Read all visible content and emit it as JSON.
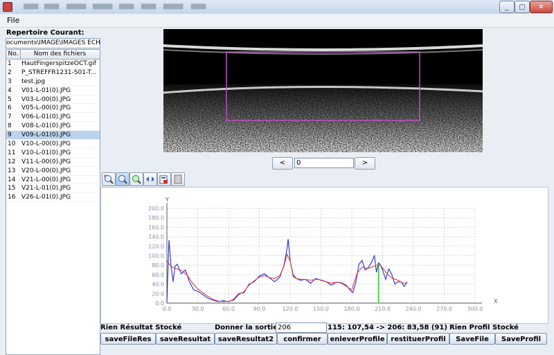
{
  "menubar": {
    "file": "File"
  },
  "left": {
    "title": "Repertoire Courant:",
    "path": "ocuments\\IMAGE\\IMAGES ECHO",
    "columns": [
      "No.",
      "Nom des fichiers"
    ],
    "files": [
      {
        "no": "1",
        "name": "HautFingerspitzeOCT.gif"
      },
      {
        "no": "2",
        "name": "P_STREFFR1231-S01-T..."
      },
      {
        "no": "3",
        "name": "test.jpg"
      },
      {
        "no": "4",
        "name": "V01-L-01(0).JPG"
      },
      {
        "no": "5",
        "name": "V03-L-00(0).JPG"
      },
      {
        "no": "6",
        "name": "V05-L-00(0).JPG"
      },
      {
        "no": "7",
        "name": "V06-L-01(0).JPG"
      },
      {
        "no": "8",
        "name": "V08-L-01(0).JPG"
      },
      {
        "no": "9",
        "name": "V09-L-01(0).JPG"
      },
      {
        "no": "10",
        "name": "V10-L-00(0).JPG"
      },
      {
        "no": "11",
        "name": "V10-L-01(0).JPG"
      },
      {
        "no": "12",
        "name": "V11-L-00(0).JPG"
      },
      {
        "no": "13",
        "name": "V20-L-00(0).JPG"
      },
      {
        "no": "14",
        "name": "V21-L-00(0).JPG"
      },
      {
        "no": "15",
        "name": "V21-L-01(0).JPG"
      },
      {
        "no": "16",
        "name": "V26-L-01(0).JPG"
      }
    ],
    "selected_no": "9"
  },
  "nav": {
    "prev": "<",
    "next": ">",
    "field_value": "0"
  },
  "toolbar": {
    "icons": [
      "zoom-fit-icon",
      "zoom-icon",
      "color-zoom-icon",
      "split-icon",
      "export-icon",
      "blank-icon"
    ]
  },
  "status": {
    "left": "Rien Résultat Stocké",
    "prompt": "Donner la sortie. x =",
    "x_value": "206",
    "readout": "115: 107,54 -> 206: 83,58 (91)",
    "right": "Rien Profil Stocké"
  },
  "buttons": [
    "saveFileRes",
    "saveResultat",
    "saveResultat2",
    "confirmer",
    "enleverProfile",
    "restituerProfil",
    "SaveFile",
    "SaveProfil"
  ],
  "colors": {
    "blue_series": "#2a2ad8",
    "red_series": "#e03c3c",
    "marker": "#22cc22",
    "roi": "#c050c8"
  },
  "chart_data": {
    "type": "line",
    "title": "",
    "xlabel": "X",
    "ylabel": "Y",
    "xlim": [
      0,
      300
    ],
    "ylim": [
      0,
      200
    ],
    "xticks": [
      "0.0",
      "30.0",
      "60.0",
      "90.0",
      "120.0",
      "150.0",
      "180.0",
      "210.0",
      "240.0",
      "270.0",
      "300.0"
    ],
    "yticks": [
      "0.0",
      "20.0",
      "40.0",
      "60.0",
      "80.0",
      "100.0",
      "120.0",
      "140.0",
      "160.0",
      "180.0",
      "200.0"
    ],
    "marker_x": 206,
    "series": [
      {
        "color": "#2a2ad8",
        "x": [
          0,
          2,
          4,
          6,
          8,
          10,
          14,
          18,
          22,
          26,
          30,
          35,
          40,
          45,
          50,
          55,
          60,
          65,
          70,
          75,
          80,
          85,
          90,
          95,
          100,
          105,
          110,
          114,
          117,
          118,
          120,
          123,
          126,
          130,
          135,
          140,
          145,
          150,
          155,
          160,
          165,
          170,
          175,
          178,
          181,
          184,
          187,
          190,
          193,
          196,
          199,
          202,
          204,
          206,
          208,
          210,
          213,
          216,
          219,
          222,
          225,
          228,
          231,
          234
        ],
        "y": [
          0,
          133,
          80,
          45,
          78,
          82,
          62,
          70,
          45,
          28,
          25,
          18,
          10,
          6,
          3,
          5,
          3,
          8,
          20,
          22,
          40,
          45,
          57,
          62,
          53,
          45,
          55,
          80,
          115,
          135,
          90,
          56,
          52,
          48,
          50,
          42,
          52,
          48,
          45,
          38,
          44,
          43,
          37,
          28,
          22,
          45,
          82,
          90,
          70,
          75,
          85,
          100,
          65,
          85,
          80,
          70,
          50,
          72,
          60,
          40,
          45,
          45,
          35,
          45
        ]
      },
      {
        "color": "#e03c3c",
        "x": [
          0,
          3,
          6,
          10,
          15,
          20,
          25,
          30,
          35,
          40,
          45,
          50,
          55,
          60,
          65,
          70,
          75,
          80,
          85,
          90,
          95,
          100,
          105,
          110,
          114,
          117,
          120,
          123,
          126,
          130,
          135,
          140,
          145,
          150,
          155,
          160,
          165,
          170,
          175,
          180,
          185,
          190,
          195,
          200,
          204,
          208,
          212,
          216,
          220,
          225,
          230,
          234
        ],
        "y": [
          90,
          80,
          75,
          72,
          68,
          58,
          42,
          30,
          22,
          14,
          8,
          4,
          3,
          4,
          6,
          18,
          24,
          38,
          47,
          55,
          58,
          54,
          52,
          58,
          78,
          103,
          88,
          60,
          52,
          50,
          50,
          48,
          50,
          49,
          45,
          42,
          44,
          42,
          35,
          28,
          62,
          76,
          73,
          76,
          80,
          80,
          68,
          58,
          52,
          48,
          42,
          42
        ]
      }
    ]
  }
}
